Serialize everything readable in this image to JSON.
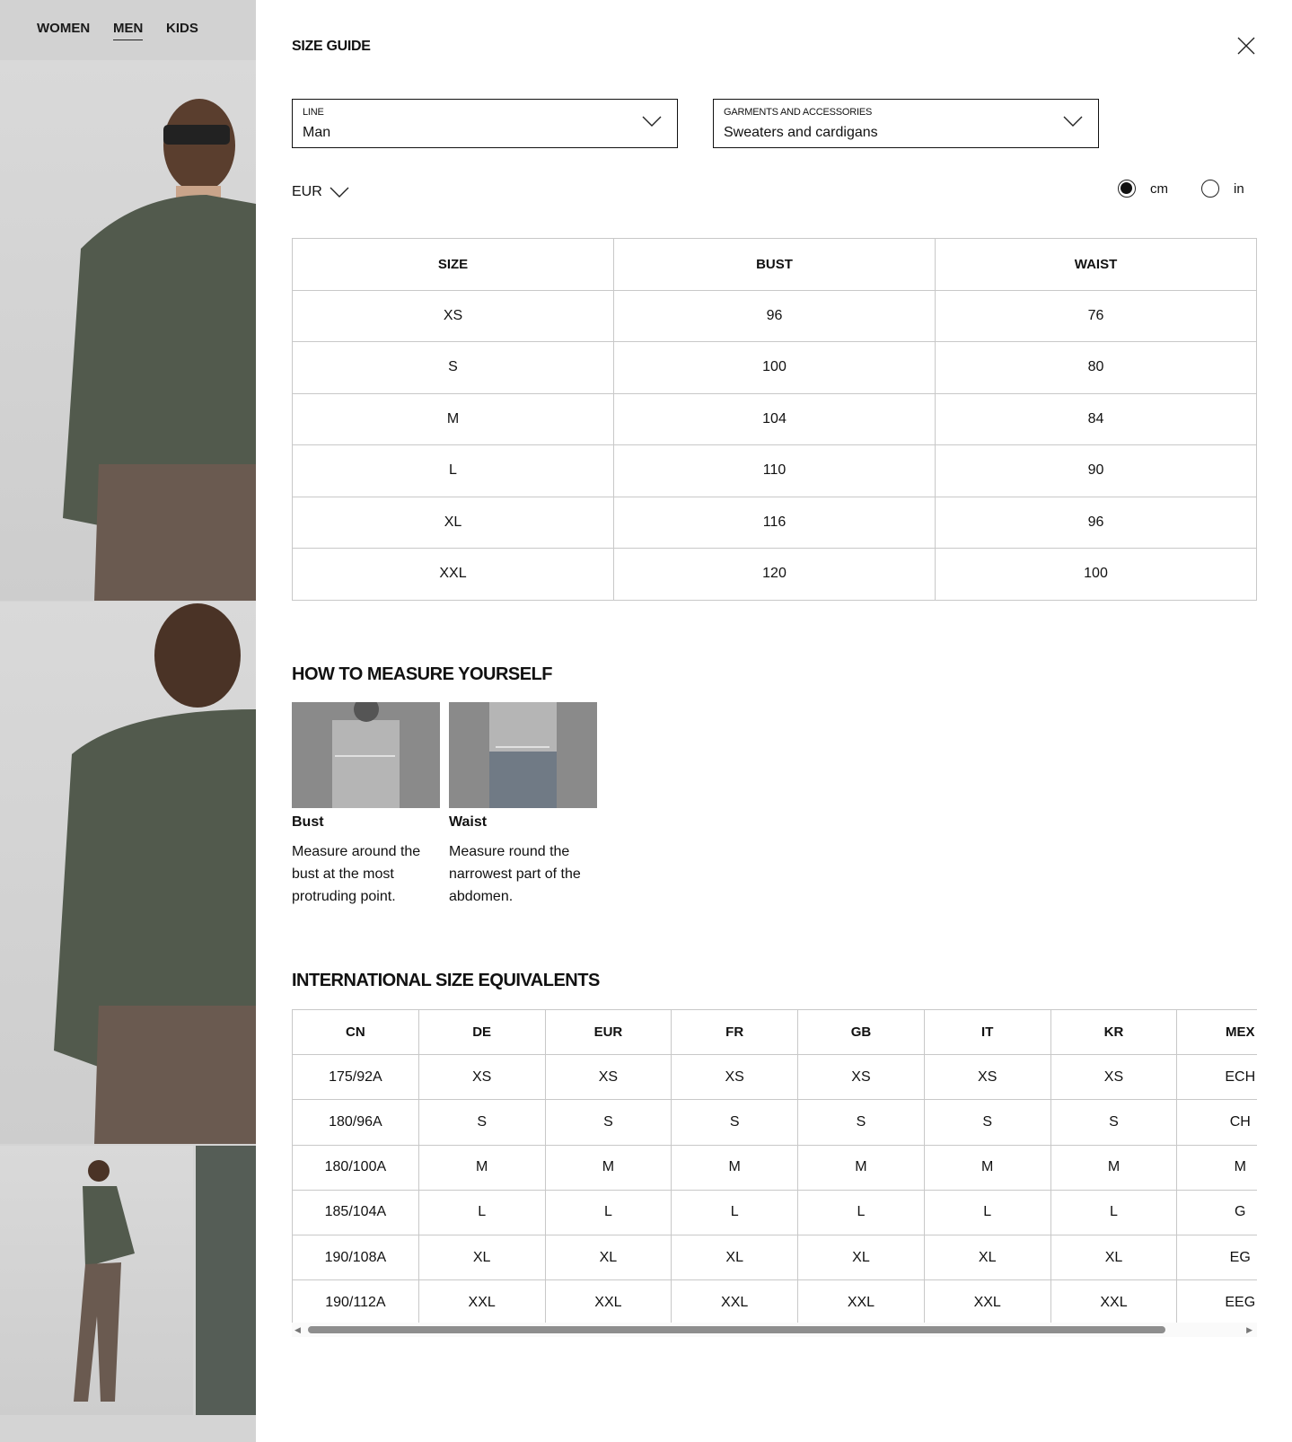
{
  "nav": {
    "items": [
      "WOMEN",
      "MEN",
      "KIDS"
    ],
    "active": "MEN"
  },
  "title": "SIZE GUIDE",
  "line_select": {
    "label": "LINE",
    "value": "Man"
  },
  "garment_select": {
    "label": "GARMENTS AND ACCESSORIES",
    "value": "Sweaters and cardigans"
  },
  "currency": "EUR",
  "units": {
    "cm": "cm",
    "in": "in",
    "selected": "cm"
  },
  "size_table": {
    "headers": [
      "SIZE",
      "BUST",
      "WAIST"
    ],
    "rows": [
      [
        "XS",
        "96",
        "76"
      ],
      [
        "S",
        "100",
        "80"
      ],
      [
        "M",
        "104",
        "84"
      ],
      [
        "L",
        "110",
        "90"
      ],
      [
        "XL",
        "116",
        "96"
      ],
      [
        "XXL",
        "120",
        "100"
      ]
    ]
  },
  "measure": {
    "heading": "HOW TO MEASURE YOURSELF",
    "items": [
      {
        "title": "Bust",
        "text": "Measure around the bust at the most protruding point."
      },
      {
        "title": "Waist",
        "text": "Measure round the narrowest part of the abdomen."
      }
    ]
  },
  "intl": {
    "heading": "INTERNATIONAL SIZE EQUIVALENTS",
    "headers": [
      "CN",
      "DE",
      "EUR",
      "FR",
      "GB",
      "IT",
      "KR",
      "MEX"
    ],
    "rows": [
      [
        "175/92A",
        "XS",
        "XS",
        "XS",
        "XS",
        "XS",
        "XS",
        "ECH"
      ],
      [
        "180/96A",
        "S",
        "S",
        "S",
        "S",
        "S",
        "S",
        "CH"
      ],
      [
        "180/100A",
        "M",
        "M",
        "M",
        "M",
        "M",
        "M",
        "M"
      ],
      [
        "185/104A",
        "L",
        "L",
        "L",
        "L",
        "L",
        "L",
        "G"
      ],
      [
        "190/108A",
        "XL",
        "XL",
        "XL",
        "XL",
        "XL",
        "XL",
        "EG"
      ],
      [
        "190/112A",
        "XXL",
        "XXL",
        "XXL",
        "XXL",
        "XXL",
        "XXL",
        "EEG"
      ]
    ]
  }
}
